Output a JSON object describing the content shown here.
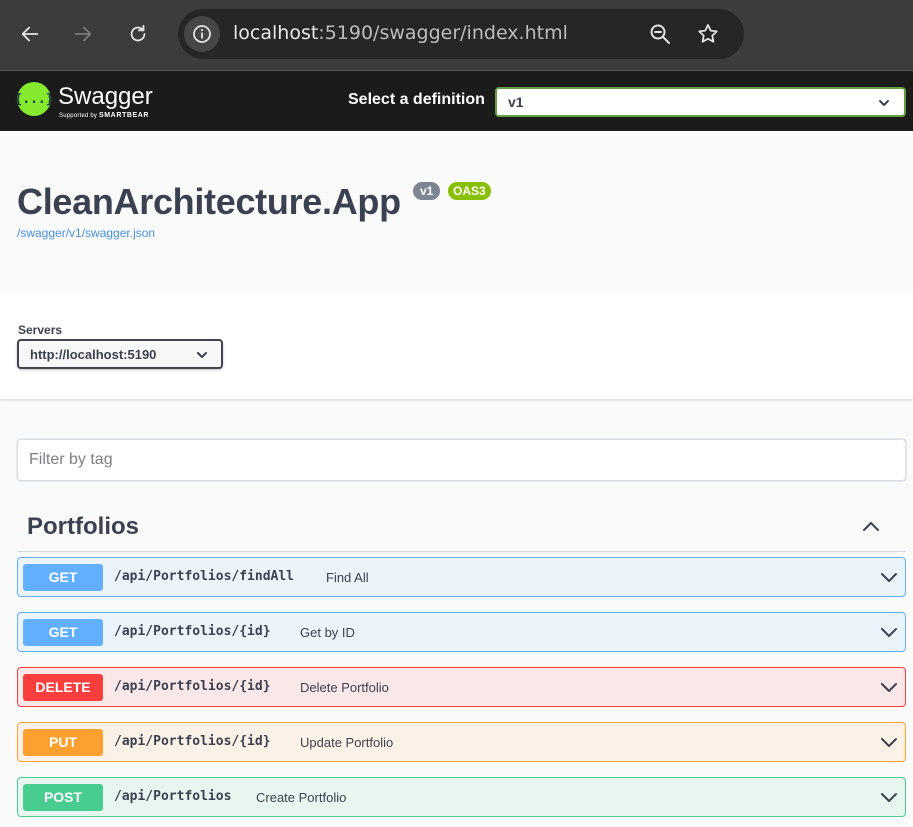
{
  "browser": {
    "url_host": "localhost",
    "url_rest": ":5190/swagger/index.html",
    "icons": [
      "back-arrow-icon",
      "forward-arrow-icon",
      "reload-icon",
      "site-info-icon",
      "zoom-icon",
      "bookmark-star-icon"
    ]
  },
  "topbar": {
    "logo_text": "Swagger",
    "logo_mark": "{...}",
    "logo_sub_prefix": "Supported by",
    "logo_sub_brand": "SMARTBEAR",
    "definition_label": "Select a definition",
    "definition_value": "v1",
    "accent_color": "#85ea2d"
  },
  "info": {
    "title": "CleanArchitecture.App",
    "version_badge": "v1",
    "oas_badge": "OAS3",
    "spec_link": "/swagger/v1/swagger.json"
  },
  "servers": {
    "label": "Servers",
    "selected": "http://localhost:5190"
  },
  "filter": {
    "placeholder": "Filter by tag"
  },
  "tag": {
    "name": "Portfolios",
    "operations": [
      {
        "method": "GET",
        "path": "/api/Portfolios/findAll",
        "summary": "Find All",
        "color": "#61affe"
      },
      {
        "method": "GET",
        "path": "/api/Portfolios/{id}",
        "summary": "Get by ID",
        "color": "#61affe"
      },
      {
        "method": "DELETE",
        "path": "/api/Portfolios/{id}",
        "summary": "Delete Portfolio",
        "color": "#f93e3e"
      },
      {
        "method": "PUT",
        "path": "/api/Portfolios/{id}",
        "summary": "Update Portfolio",
        "color": "#fca130"
      },
      {
        "method": "POST",
        "path": "/api/Portfolios",
        "summary": "Create Portfolio",
        "color": "#49cc90"
      }
    ]
  }
}
